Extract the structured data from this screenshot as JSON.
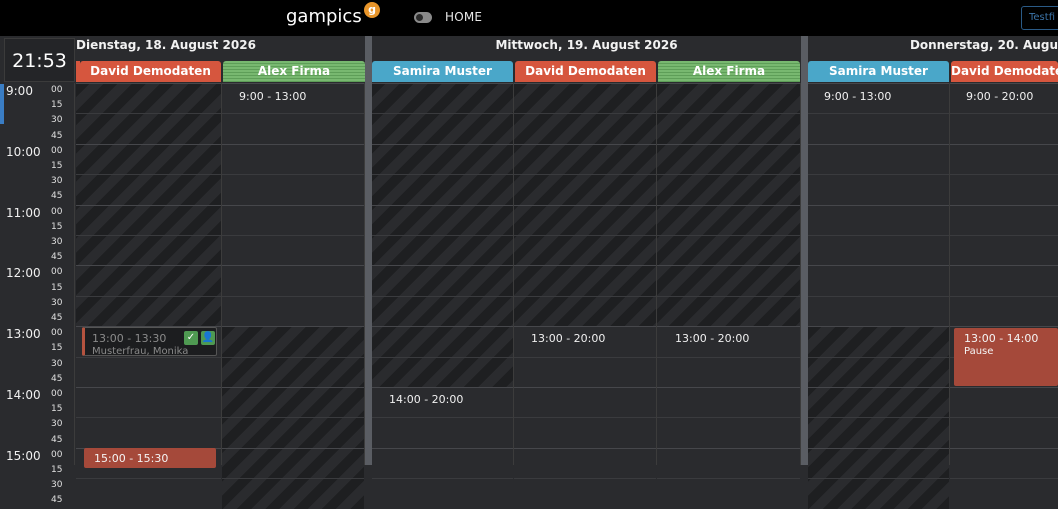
{
  "topbar": {
    "brand": "gampics",
    "brand_badge": "g",
    "home_label": "HOME",
    "test_button_label": "Testfi"
  },
  "clock": "21:53",
  "timeline": {
    "hours": [
      "9:00",
      "10:00",
      "11:00",
      "12:00",
      "13:00",
      "14:00",
      "15:00"
    ],
    "minutes": [
      "00",
      "15",
      "30",
      "45"
    ]
  },
  "days": [
    {
      "title": "Dienstag, 18. August 2026",
      "columns": [
        {
          "name": "David Demodaten",
          "color": "red"
        },
        {
          "name": "Alex Firma",
          "color": "green"
        }
      ]
    },
    {
      "title": "Mittwoch, 19. August 2026",
      "columns": [
        {
          "name": "Samira Muster",
          "color": "blue"
        },
        {
          "name": "David Demodaten",
          "color": "red"
        },
        {
          "name": "Alex Firma",
          "color": "green"
        }
      ]
    },
    {
      "title": "Donnerstag, 20. Augu",
      "columns": [
        {
          "name": "Samira Muster",
          "color": "blue"
        },
        {
          "name": "David Demodate",
          "color": "red"
        }
      ]
    }
  ],
  "availability": {
    "tue_alex": "9:00 - 13:00",
    "wed_samira": "14:00 - 20:00",
    "wed_david": "13:00 - 20:00",
    "wed_alex": "13:00 - 20:00",
    "thu_samira": "9:00 - 13:00",
    "thu_david": "9:00 - 20:00"
  },
  "events": {
    "tue_booking": {
      "time": "13:00 - 13:30",
      "name": "Musterfrau, Monika",
      "icons": [
        "check-icon",
        "user-check-icon"
      ]
    },
    "tue_block": {
      "time": "15:00 - 15:30"
    },
    "thu_pause": {
      "time": "13:00 - 14:00",
      "label": "Pause"
    }
  },
  "colors": {
    "red": "#d6563e",
    "blue": "#4aa7c9",
    "green": "#78b870",
    "accent": "#e8952a"
  }
}
